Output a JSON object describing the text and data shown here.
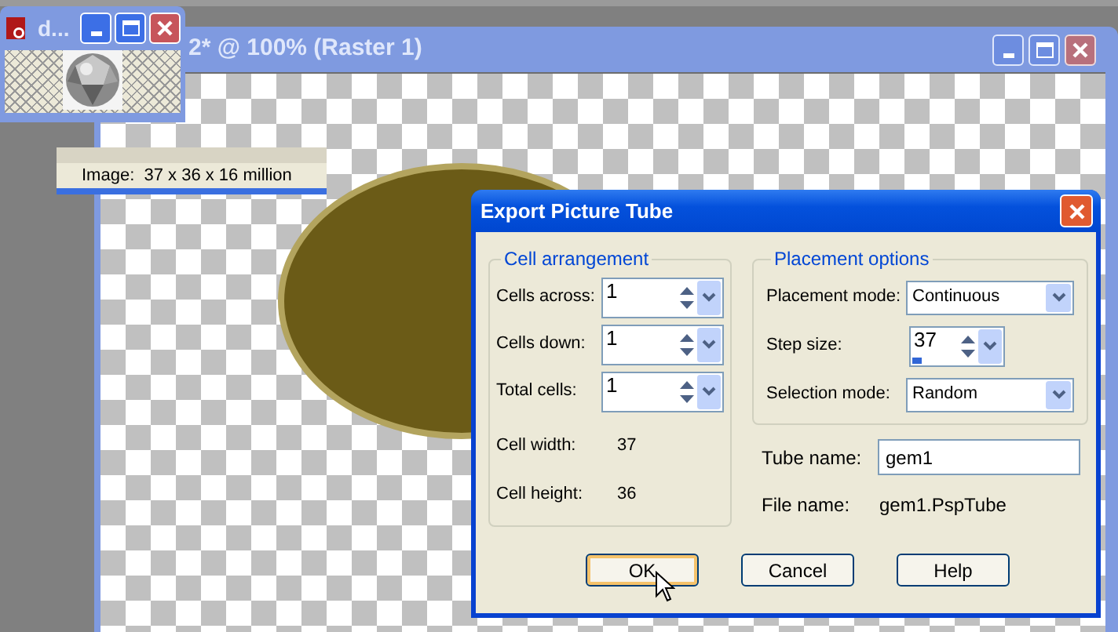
{
  "image_window": {
    "title": "2* @ 100% (Raster 1)"
  },
  "preview_window": {
    "title": "d..."
  },
  "status_bar": {
    "text": "Image:  37 x 36 x 16 million"
  },
  "dialog": {
    "title": "Export Picture Tube",
    "cell_arrangement": {
      "title": "Cell arrangement",
      "fields": [
        {
          "label": "Cells across:",
          "value": "1"
        },
        {
          "label": "Cells down:",
          "value": "1"
        },
        {
          "label": "Total cells:",
          "value": "1"
        }
      ],
      "info": [
        {
          "label": "Cell width:",
          "value": "37"
        },
        {
          "label": "Cell height:",
          "value": "36"
        }
      ]
    },
    "placement_options": {
      "title": "Placement options",
      "rows": [
        {
          "kind": "dropdown",
          "label": "Placement mode:",
          "value": "Continuous"
        },
        {
          "kind": "spin",
          "label": "Step size:",
          "value": "37",
          "level": 0.1
        },
        {
          "kind": "dropdown",
          "label": "Selection mode:",
          "value": "Random"
        }
      ]
    },
    "tube_name": {
      "label": "Tube name:",
      "value": "gem1"
    },
    "file_name": {
      "label": "File name:",
      "value": "gem1.PspTube"
    },
    "buttons": [
      {
        "label": "OK",
        "focused": true
      },
      {
        "label": "Cancel",
        "focused": false
      },
      {
        "label": "Help",
        "focused": false
      }
    ]
  }
}
